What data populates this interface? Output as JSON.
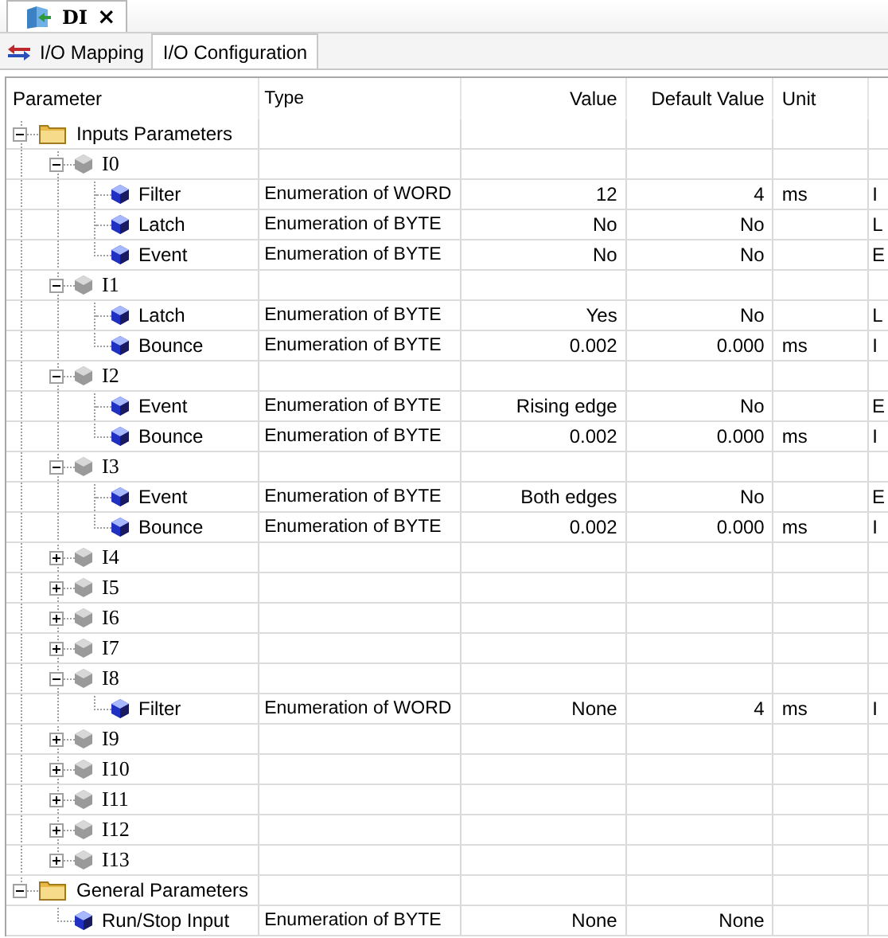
{
  "document_tab": {
    "title": "DI",
    "close": "×"
  },
  "tabs": [
    {
      "label": "I/O Mapping",
      "selected": false,
      "kind": "mapping"
    },
    {
      "label": "I/O Configuration",
      "selected": true,
      "kind": "config"
    }
  ],
  "table": {
    "columns": [
      "Parameter",
      "Type",
      "Value",
      "Default Value",
      "Unit"
    ],
    "rows": [
      {
        "kind": "folder",
        "name": "Inputs Parameters",
        "expanded": true,
        "children": [
          {
            "kind": "channel",
            "name": "I0",
            "expanded": true,
            "children": [
              {
                "kind": "param",
                "name": "Filter",
                "type": "Enumeration of WORD",
                "value": "12",
                "default": "4",
                "unit": "ms",
                "column_6": "I"
              },
              {
                "kind": "param",
                "name": "Latch",
                "type": "Enumeration of BYTE",
                "value": "No",
                "default": "No",
                "column_6": "L"
              },
              {
                "kind": "param",
                "name": "Event",
                "type": "Enumeration of BYTE",
                "value": "No",
                "default": "No",
                "column_6": "E"
              }
            ]
          },
          {
            "kind": "channel",
            "name": "I1",
            "expanded": true,
            "children": [
              {
                "kind": "param",
                "name": "Latch",
                "type": "Enumeration of BYTE",
                "value": "Yes",
                "default": "No",
                "column_6": "L"
              },
              {
                "kind": "param",
                "name": "Bounce",
                "type": "Enumeration of BYTE",
                "value": "0.002",
                "default": "0.000",
                "unit": "ms",
                "column_6": "I"
              }
            ]
          },
          {
            "kind": "channel",
            "name": "I2",
            "expanded": true,
            "children": [
              {
                "kind": "param",
                "name": "Event",
                "type": "Enumeration of BYTE",
                "value": "Rising edge",
                "default": "No",
                "column_6": "E"
              },
              {
                "kind": "param",
                "name": "Bounce",
                "type": "Enumeration of BYTE",
                "value": "0.002",
                "default": "0.000",
                "unit": "ms",
                "column_6": "I"
              }
            ]
          },
          {
            "kind": "channel",
            "name": "I3",
            "expanded": true,
            "children": [
              {
                "kind": "param",
                "name": "Event",
                "type": "Enumeration of BYTE",
                "value": "Both edges",
                "default": "No",
                "column_6": "E"
              },
              {
                "kind": "param",
                "name": "Bounce",
                "type": "Enumeration of BYTE",
                "value": "0.002",
                "default": "0.000",
                "unit": "ms",
                "column_6": "I"
              }
            ]
          },
          {
            "kind": "channel",
            "name": "I4",
            "expanded": false
          },
          {
            "kind": "channel",
            "name": "I5",
            "expanded": false
          },
          {
            "kind": "channel",
            "name": "I6",
            "expanded": false
          },
          {
            "kind": "channel",
            "name": "I7",
            "expanded": false
          },
          {
            "kind": "channel",
            "name": "I8",
            "expanded": true,
            "children": [
              {
                "kind": "param",
                "name": "Filter",
                "type": "Enumeration of WORD",
                "value": "None",
                "default": "4",
                "unit": "ms",
                "column_6": "I"
              }
            ]
          },
          {
            "kind": "channel",
            "name": "I9",
            "expanded": false
          },
          {
            "kind": "channel",
            "name": "I10",
            "expanded": false
          },
          {
            "kind": "channel",
            "name": "I11",
            "expanded": false
          },
          {
            "kind": "channel",
            "name": "I12",
            "expanded": false
          },
          {
            "kind": "channel",
            "name": "I13",
            "expanded": false
          }
        ]
      },
      {
        "kind": "folder",
        "name": "General Parameters",
        "expanded": true,
        "children": [
          {
            "kind": "param",
            "name": "Run/Stop Input",
            "type": "Enumeration of BYTE",
            "value": "None",
            "default": "None"
          }
        ]
      }
    ]
  }
}
